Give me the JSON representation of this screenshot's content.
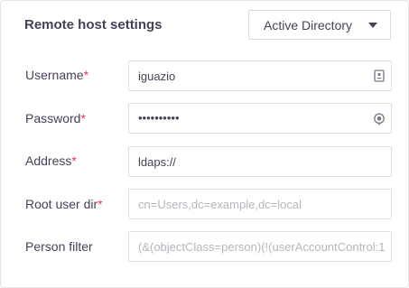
{
  "panel": {
    "title": "Remote host settings",
    "directory_type": {
      "selected": "Active Directory"
    }
  },
  "fields": {
    "username": {
      "label": "Username",
      "required_mark": "*",
      "value": "iguazio",
      "icon": "contact-card-icon"
    },
    "password": {
      "label": "Password",
      "required_mark": "*",
      "value": "••••••••••",
      "icon": "eye-icon"
    },
    "address": {
      "label": "Address",
      "required_mark": "*",
      "value": "ldaps://"
    },
    "root_user_dir": {
      "label": "Root user dir",
      "required_mark": "*",
      "placeholder": "cn=Users,dc=example,dc=local"
    },
    "person_filter": {
      "label": "Person filter",
      "placeholder": "(&(objectClass=person)(!(userAccountControl:1"
    }
  },
  "colors": {
    "text": "#483f56",
    "required": "#e33a5f",
    "placeholder": "#b7b4bd",
    "border": "#e0dfe3"
  }
}
